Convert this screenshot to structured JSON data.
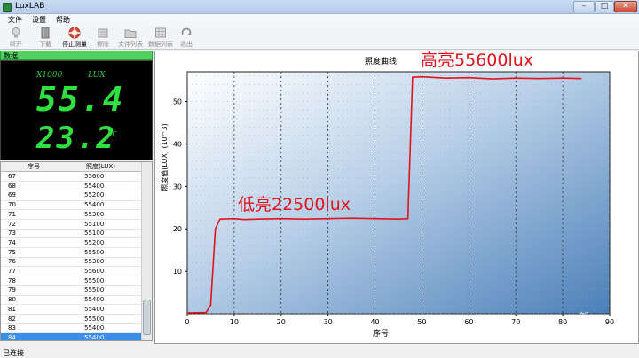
{
  "window": {
    "title": "LuxLAB",
    "controls": [
      "–",
      "□",
      "✕"
    ]
  },
  "menu": [
    "文件",
    "设置",
    "帮助"
  ],
  "toolbar": [
    {
      "label": "断开",
      "icon": "bulb-icon",
      "enabled": false
    },
    {
      "label": "下载",
      "icon": "book-icon",
      "enabled": false
    },
    {
      "label": "停止测量",
      "icon": "lifebuoy-icon",
      "enabled": true
    },
    {
      "label": "擦除",
      "icon": "eraser-icon",
      "enabled": false
    },
    {
      "label": "文件列表",
      "icon": "folder-icon",
      "enabled": false
    },
    {
      "label": "数据列表",
      "icon": "grid-icon",
      "enabled": false
    },
    {
      "label": "退出",
      "icon": "exit-icon",
      "enabled": false
    }
  ],
  "panel": {
    "title": "数据",
    "lcd": {
      "multiplier": "X1000",
      "unit": "LUX",
      "lux": "55.4",
      "temp": "23.2",
      "temp_unit": "℃"
    }
  },
  "table": {
    "headers": [
      "序号",
      "照度(LUX)"
    ],
    "rows": [
      [
        "67",
        "55600"
      ],
      [
        "68",
        "55400"
      ],
      [
        "69",
        "55200"
      ],
      [
        "70",
        "55400"
      ],
      [
        "71",
        "55300"
      ],
      [
        "72",
        "55100"
      ],
      [
        "73",
        "55100"
      ],
      [
        "74",
        "55200"
      ],
      [
        "75",
        "55500"
      ],
      [
        "76",
        "55300"
      ],
      [
        "77",
        "55600"
      ],
      [
        "78",
        "55500"
      ],
      [
        "79",
        "55500"
      ],
      [
        "80",
        "55400"
      ],
      [
        "81",
        "55400"
      ],
      [
        "82",
        "55500"
      ],
      [
        "83",
        "55400"
      ],
      [
        "84",
        "55400"
      ]
    ],
    "selected_index": 17
  },
  "annotations": {
    "high": "高亮55600lux",
    "low": "低亮22500lux"
  },
  "status": "已连接",
  "watermark": [
    "新",
    "浪",
    "众测"
  ],
  "chart_data": {
    "type": "line",
    "title": "照度曲线",
    "xlabel": "序号",
    "ylabel": "照度值(LUX) (10^3)",
    "xlim": [
      0,
      90
    ],
    "ylim": [
      0,
      57
    ],
    "xticks": [
      0,
      10,
      20,
      30,
      40,
      50,
      60,
      70,
      80,
      90
    ],
    "yticks": [
      10,
      20,
      30,
      40,
      50
    ],
    "grid": true,
    "series": [
      {
        "color": "#e0141e",
        "points": [
          [
            0,
            0.2
          ],
          [
            4,
            0.3
          ],
          [
            5,
            2
          ],
          [
            6,
            20
          ],
          [
            7,
            22.3
          ],
          [
            10,
            22.4
          ],
          [
            12,
            22.2
          ],
          [
            15,
            22.3
          ],
          [
            20,
            22.4
          ],
          [
            25,
            22.3
          ],
          [
            30,
            22.4
          ],
          [
            35,
            22.5
          ],
          [
            40,
            22.4
          ],
          [
            45,
            22.3
          ],
          [
            47,
            22.4
          ],
          [
            48,
            55.7
          ],
          [
            50,
            55.8
          ],
          [
            55,
            55.5
          ],
          [
            60,
            55.6
          ],
          [
            65,
            55.3
          ],
          [
            70,
            55.5
          ],
          [
            75,
            55.4
          ],
          [
            80,
            55.5
          ],
          [
            84,
            55.4
          ]
        ]
      }
    ]
  }
}
